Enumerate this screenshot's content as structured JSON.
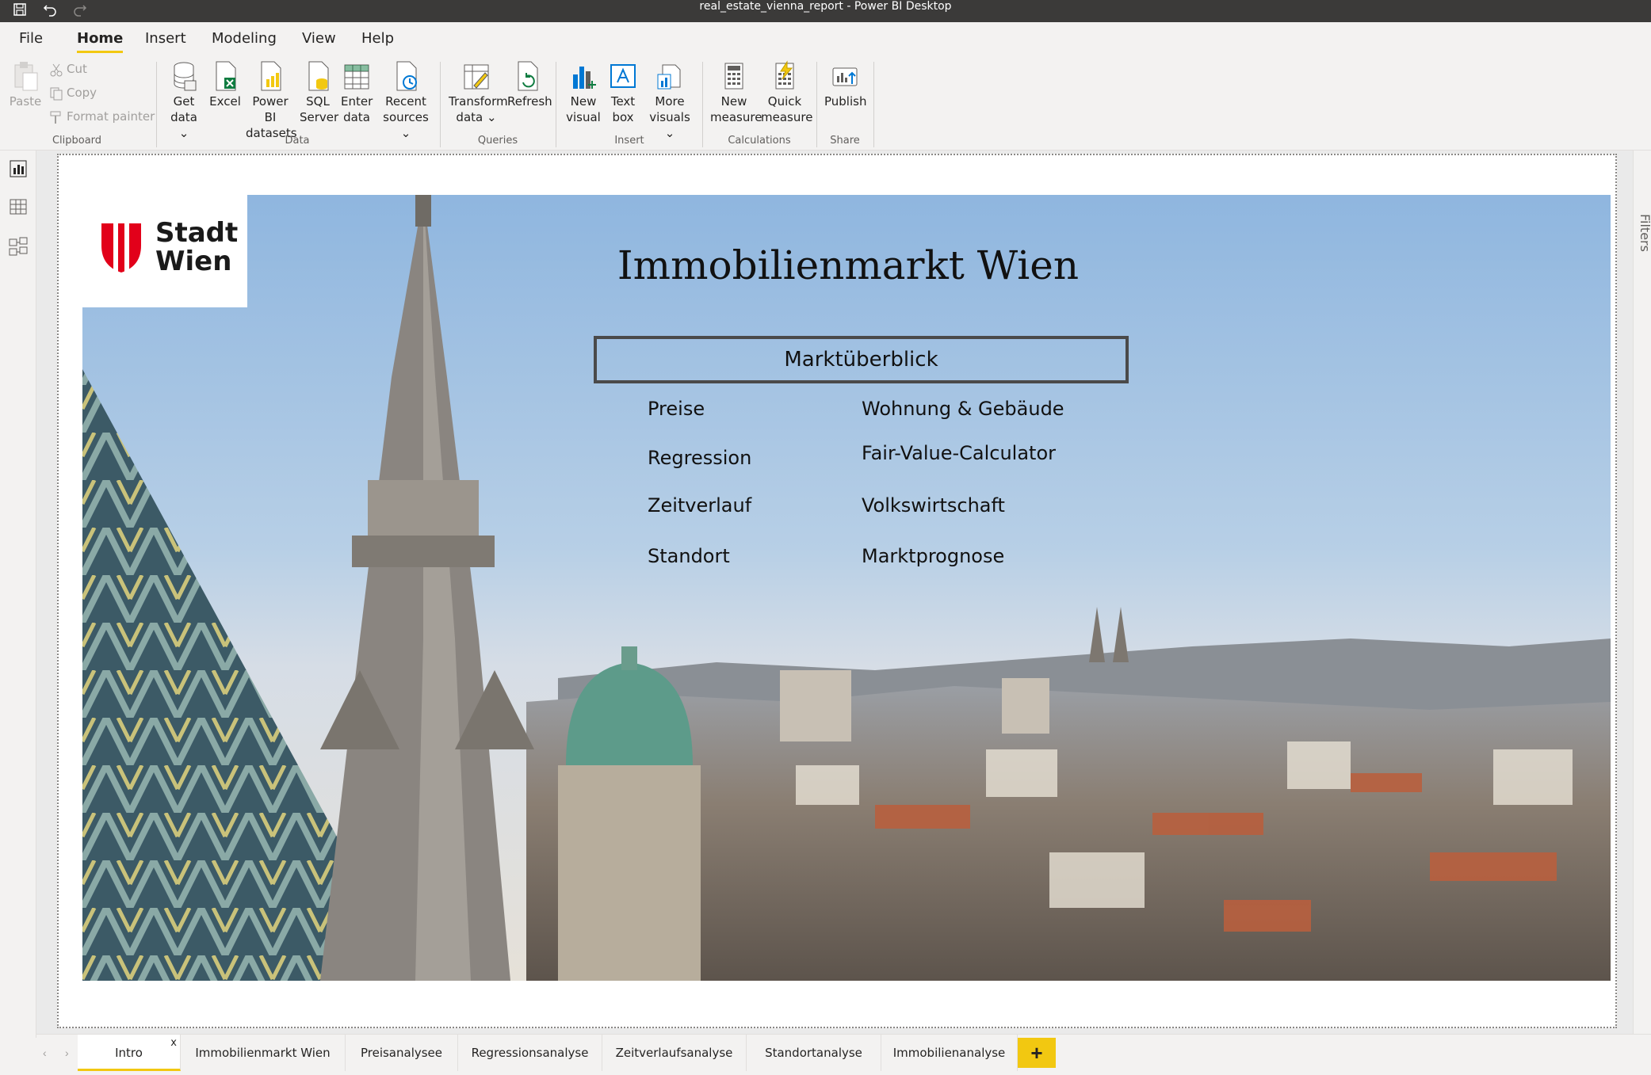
{
  "window": {
    "title": "real_estate_vienna_report - Power BI Desktop"
  },
  "menu": [
    "File",
    "Home",
    "Insert",
    "Modeling",
    "View",
    "Help"
  ],
  "ribbon": {
    "clipboard": {
      "paste": "Paste",
      "cut": "Cut",
      "copy": "Copy",
      "format_painter": "Format painter",
      "label": "Clipboard"
    },
    "data": {
      "get_data": [
        "Get",
        "data"
      ],
      "excel": "Excel",
      "pbi_datasets": [
        "Power BI",
        "datasets"
      ],
      "sql": [
        "SQL",
        "Server"
      ],
      "enter_data": [
        "Enter",
        "data"
      ],
      "recent": [
        "Recent",
        "sources"
      ],
      "label": "Data"
    },
    "queries": {
      "transform": [
        "Transform",
        "data"
      ],
      "refresh": "Refresh",
      "label": "Queries"
    },
    "insert": {
      "new_visual": [
        "New",
        "visual"
      ],
      "text_box": [
        "Text",
        "box"
      ],
      "more_visuals": [
        "More",
        "visuals"
      ],
      "label": "Insert"
    },
    "calculations": {
      "new_measure": [
        "New",
        "measure"
      ],
      "quick_measure": [
        "Quick",
        "measure"
      ],
      "label": "Calculations"
    },
    "share": {
      "publish": "Publish",
      "label": "Share"
    }
  },
  "report": {
    "logo": [
      "Stadt",
      "Wien"
    ],
    "title": "Immobilienmarkt Wien",
    "overview": "Marktüberblick",
    "links_left": [
      "Preise",
      "Regression",
      "Zeitverlauf",
      "Standort"
    ],
    "links_right": [
      "Wohnung & Gebäude",
      "Fair-Value-Calculator",
      "Volkswirtschaft",
      "Marktprognose"
    ]
  },
  "filters_label": "Filters",
  "tabs": [
    "Intro",
    "Immobilienmarkt Wien",
    "Preisanalysee",
    "Regressionsanalyse",
    "Zeitverlaufsanalyse",
    "Standortanalyse",
    "Immobilienanalyse"
  ],
  "add_tab": "+",
  "colors": {
    "accent": "#f2c811",
    "titlebar": "#3b3a39",
    "wien_red": "#e2001a"
  }
}
